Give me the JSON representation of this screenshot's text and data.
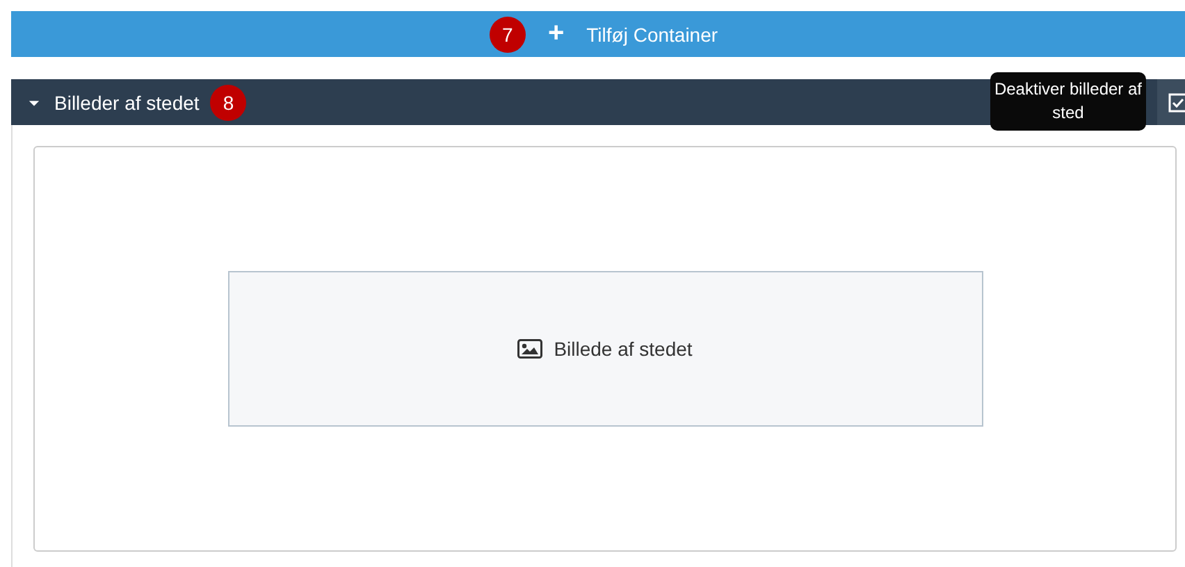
{
  "add_bar": {
    "badge": "7",
    "icon": "+",
    "label": "Tilføj Container"
  },
  "section": {
    "title": "Billeder af stedet",
    "badge": "8",
    "expanded": true,
    "toggle_checked": true,
    "tooltip": "Deaktiver billeder af sted"
  },
  "placeholder": {
    "label": "Billede af stedet"
  }
}
